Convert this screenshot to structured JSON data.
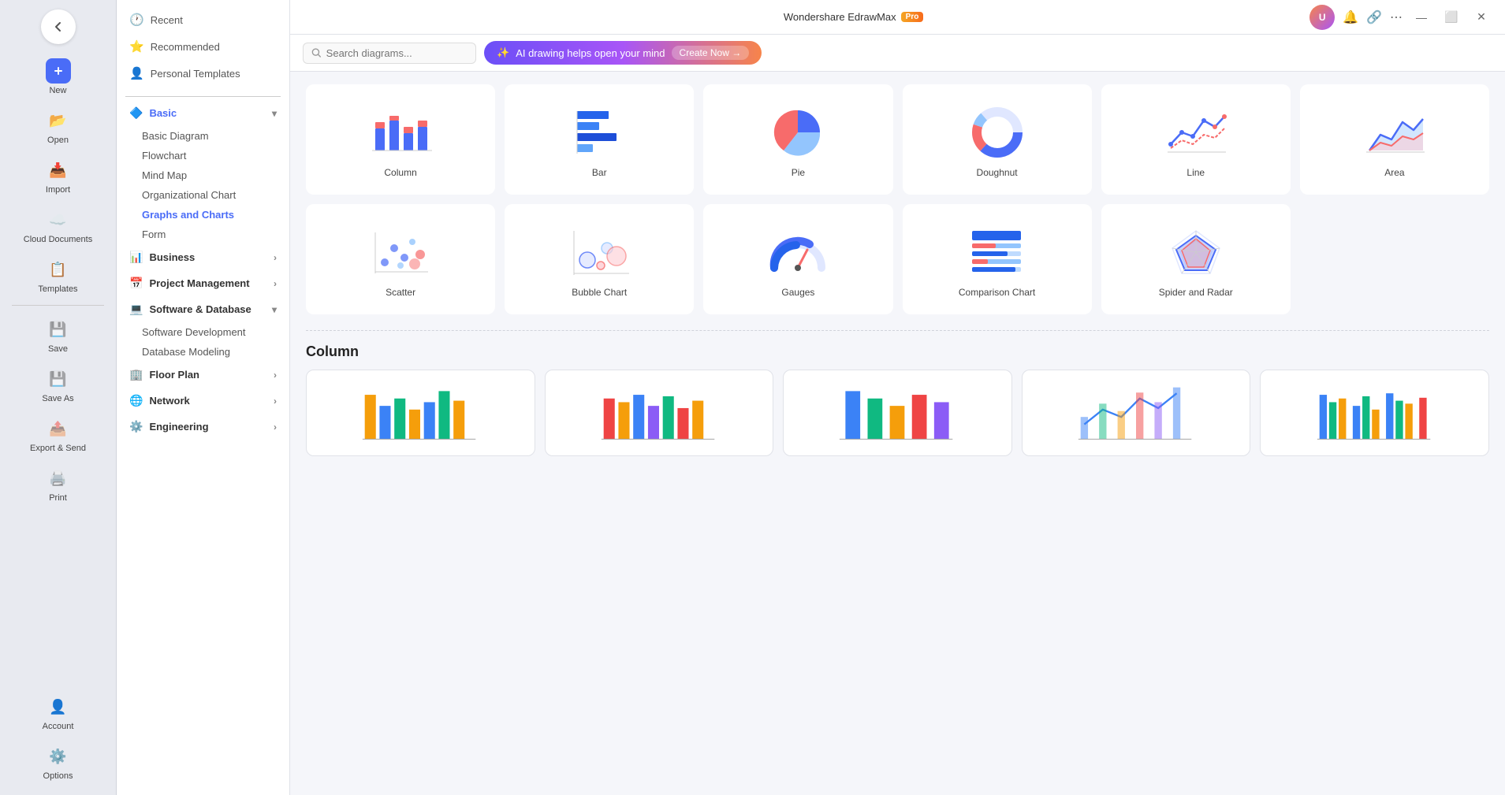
{
  "app": {
    "title": "Wondershare EdrawMax",
    "pro_label": "Pro"
  },
  "sidebar": {
    "items": [
      {
        "id": "new",
        "label": "New",
        "icon": "➕"
      },
      {
        "id": "open",
        "label": "Open",
        "icon": "📂"
      },
      {
        "id": "import",
        "label": "Import",
        "icon": "📥"
      },
      {
        "id": "cloud",
        "label": "Cloud Documents",
        "icon": "☁️"
      },
      {
        "id": "templates",
        "label": "Templates",
        "icon": "📋"
      },
      {
        "id": "save",
        "label": "Save",
        "icon": "💾"
      },
      {
        "id": "saveas",
        "label": "Save As",
        "icon": "💾"
      },
      {
        "id": "export",
        "label": "Export & Send",
        "icon": "📤"
      },
      {
        "id": "print",
        "label": "Print",
        "icon": "🖨️"
      }
    ],
    "bottom": [
      {
        "id": "account",
        "label": "Account",
        "icon": "👤"
      },
      {
        "id": "options",
        "label": "Options",
        "icon": "⚙️"
      }
    ]
  },
  "nav": {
    "items": [
      {
        "id": "recent",
        "label": "Recent",
        "icon": "🕐"
      },
      {
        "id": "recommended",
        "label": "Recommended",
        "icon": "⭐"
      },
      {
        "id": "personal",
        "label": "Personal Templates",
        "icon": "👤"
      }
    ],
    "categories": [
      {
        "id": "basic",
        "label": "Basic",
        "expanded": true,
        "subs": [
          "Basic Diagram",
          "Flowchart",
          "Mind Map",
          "Organizational Chart",
          "Graphs and Charts",
          "Form"
        ]
      },
      {
        "id": "business",
        "label": "Business",
        "expanded": false,
        "subs": []
      },
      {
        "id": "project",
        "label": "Project Management",
        "expanded": false,
        "subs": []
      },
      {
        "id": "software",
        "label": "Software & Database",
        "expanded": true,
        "subs": [
          "Software Development",
          "Database Modeling"
        ]
      },
      {
        "id": "floor",
        "label": "Floor Plan",
        "expanded": false,
        "subs": []
      },
      {
        "id": "network",
        "label": "Network",
        "expanded": false,
        "subs": []
      },
      {
        "id": "engineering",
        "label": "Engineering",
        "expanded": false,
        "subs": []
      }
    ]
  },
  "toolbar": {
    "search_placeholder": "Search diagrams...",
    "ai_banner_text": "AI drawing helps open your mind",
    "ai_create_label": "Create Now →"
  },
  "charts": [
    {
      "id": "column",
      "label": "Column"
    },
    {
      "id": "bar",
      "label": "Bar"
    },
    {
      "id": "pie",
      "label": "Pie"
    },
    {
      "id": "doughnut",
      "label": "Doughnut"
    },
    {
      "id": "line",
      "label": "Line"
    },
    {
      "id": "area",
      "label": "Area"
    },
    {
      "id": "scatter",
      "label": "Scatter"
    },
    {
      "id": "bubble",
      "label": "Bubble Chart"
    },
    {
      "id": "gauges",
      "label": "Gauges"
    },
    {
      "id": "comparison",
      "label": "Comparison Chart"
    },
    {
      "id": "spider",
      "label": "Spider and Radar"
    }
  ],
  "section_title": "Column",
  "templates_count": 5,
  "window_controls": {
    "minimize": "—",
    "maximize": "⬜",
    "close": "✕"
  },
  "active_sub": "Graphs and Charts"
}
